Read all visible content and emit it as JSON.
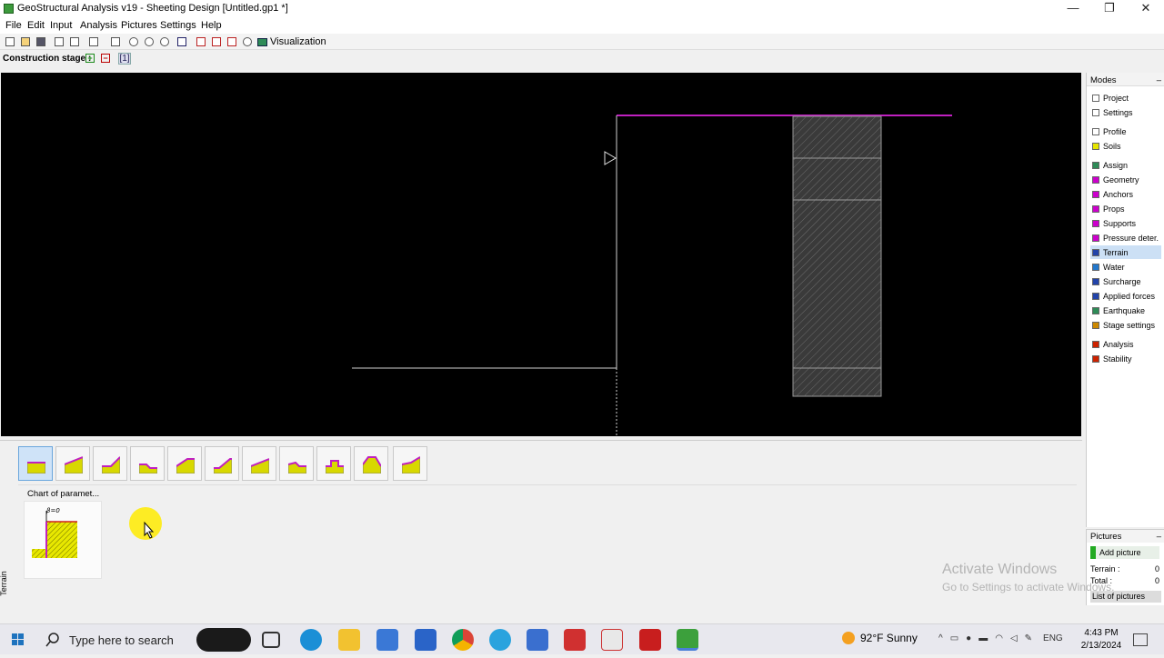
{
  "window": {
    "title": "GeoStructural Analysis v19 - Sheeting Design [Untitled.gp1 *]",
    "minimize": "—",
    "maximize": "❐",
    "close": "✕"
  },
  "menu": [
    "File",
    "Edit",
    "Input",
    "Analysis",
    "Pictures",
    "Settings",
    "Help"
  ],
  "toolbar": {
    "visualization_label": "Visualization"
  },
  "stage": {
    "label": "Construction stage :",
    "add": "+",
    "remove": "−",
    "current": "[1]"
  },
  "bottom": {
    "chart_label": "Chart of paramet...",
    "tab_label": "Terrain",
    "beta_label": "β=0"
  },
  "modes": {
    "header": "Modes",
    "collapse": "–",
    "items": [
      {
        "label": "Project",
        "color": "#ffffff"
      },
      {
        "label": "Settings",
        "color": "#ffffff"
      },
      {
        "label": "Profile",
        "color": "#ffffff"
      },
      {
        "label": "Soils",
        "color": "#e6e600"
      },
      {
        "label": "Assign",
        "color": "#2e8b57"
      },
      {
        "label": "Geometry",
        "color": "#cc00cc"
      },
      {
        "label": "Anchors",
        "color": "#cc00cc"
      },
      {
        "label": "Props",
        "color": "#cc00cc"
      },
      {
        "label": "Supports",
        "color": "#cc00cc"
      },
      {
        "label": "Pressure deter.",
        "color": "#cc00cc"
      },
      {
        "label": "Terrain",
        "color": "#2244aa",
        "selected": true
      },
      {
        "label": "Water",
        "color": "#2277cc"
      },
      {
        "label": "Surcharge",
        "color": "#2244aa"
      },
      {
        "label": "Applied forces",
        "color": "#2244aa"
      },
      {
        "label": "Earthquake",
        "color": "#2e8b57"
      },
      {
        "label": "Stage settings",
        "color": "#cc8800"
      },
      {
        "label": "Analysis",
        "color": "#cc2200"
      },
      {
        "label": "Stability",
        "color": "#cc2200"
      }
    ]
  },
  "pictures": {
    "header": "Pictures",
    "collapse": "–",
    "add": "Add picture",
    "terrain_label": "Terrain :",
    "terrain_count": "0",
    "total_label": "Total :",
    "total_count": "0",
    "list": "List of pictures"
  },
  "watermark": {
    "line1": "Activate Windows",
    "line2": "Go to Settings to activate Windows."
  },
  "taskbar": {
    "search_placeholder": "Type here to search",
    "weather": "92°F  Sunny",
    "lang": "ENG",
    "time": "4:43 PM",
    "date": "2/13/2024"
  }
}
